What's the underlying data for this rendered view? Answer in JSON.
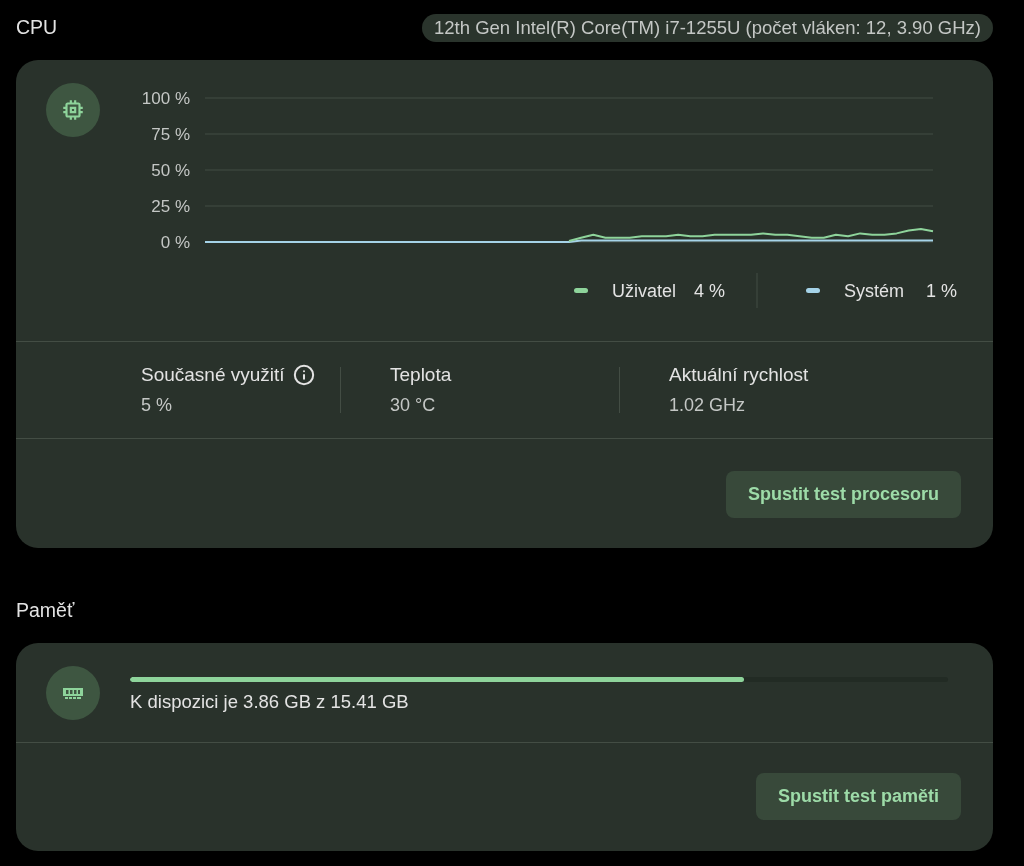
{
  "cpu": {
    "title": "CPU",
    "processor": "12th Gen Intel(R) Core(TM) i7-1255U (počet vláken: 12, 3.90 GHz)",
    "chart_data": {
      "type": "line",
      "grid": true,
      "legend": "bottom-right",
      "ylim": [
        0,
        100
      ],
      "yticks": [
        {
          "value": 0,
          "label": "0 %"
        },
        {
          "value": 25,
          "label": "25 %"
        },
        {
          "value": 50,
          "label": "50 %"
        },
        {
          "value": 75,
          "label": "75 %"
        },
        {
          "value": 100,
          "label": "100 %"
        }
      ],
      "series": [
        {
          "name": "Uživatel",
          "color": "#8ed49b",
          "values": [
            null,
            null,
            null,
            null,
            null,
            null,
            null,
            null,
            null,
            null,
            null,
            null,
            null,
            null,
            null,
            null,
            null,
            null,
            null,
            null,
            null,
            null,
            null,
            null,
            null,
            null,
            null,
            null,
            null,
            null,
            0.7,
            3,
            5,
            3,
            3,
            3,
            4,
            4,
            4,
            5,
            4,
            4,
            5,
            5,
            5,
            5,
            6,
            5,
            5,
            4,
            3,
            3,
            5,
            4,
            6,
            5,
            5,
            6,
            8,
            9,
            7.5
          ]
        },
        {
          "name": "Systém",
          "color": "#a5d3e8",
          "values": [
            0,
            0,
            0,
            0,
            0,
            0,
            0,
            0,
            0,
            0,
            0,
            0,
            0,
            0,
            0,
            0,
            0,
            0,
            0,
            0,
            0,
            0,
            0,
            0,
            0,
            0,
            0,
            0,
            0,
            0,
            0,
            1,
            1,
            1,
            1,
            1,
            1,
            1,
            1,
            1,
            1,
            1,
            1,
            1,
            1,
            1,
            1,
            1,
            1,
            1,
            1,
            1,
            1,
            1,
            1,
            1,
            1,
            1,
            1,
            1,
            1
          ]
        }
      ]
    },
    "legend": [
      {
        "reading": "4 %"
      },
      {
        "reading": "1 %"
      }
    ],
    "stats": [
      {
        "label": "Současné využití",
        "value": "5 %",
        "info": true
      },
      {
        "label": "Teplota",
        "value": "30 °C",
        "info": false
      },
      {
        "label": "Aktuální rychlost",
        "value": "1.02 GHz",
        "info": false
      }
    ],
    "button": "Spustit test procesoru"
  },
  "memory": {
    "title": "Paměť",
    "usage": {
      "level": 0.75
    },
    "summary": "K dispozici je 3.86 GB z 15.41 GB",
    "button": "Spustit test paměti"
  }
}
